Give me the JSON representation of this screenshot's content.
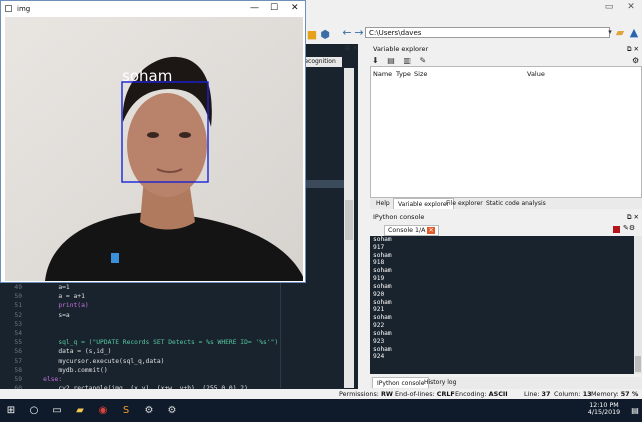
{
  "spyder": {
    "path_value": "C:\\Users\\daves",
    "editor_tab": "recognition",
    "variable_explorer": {
      "title": "Variable explorer",
      "columns": [
        "Name",
        "Type",
        "Size",
        "Value"
      ]
    },
    "bottom_tabs": [
      "Help",
      "Variable explorer",
      "File explorer",
      "Static code analysis"
    ],
    "ipython": {
      "title": "IPython console",
      "tab": "Console 1/A",
      "lines": [
        "soham",
        "917",
        "soham",
        "918",
        "soham",
        "919",
        "soham",
        "920",
        "soham",
        "921",
        "soham",
        "922",
        "soham",
        "923",
        "soham",
        "924"
      ]
    },
    "console_tabs": [
      "IPython console",
      "History log"
    ],
    "code": [
      {
        "n": "49",
        "text": "        a=1"
      },
      {
        "n": "50",
        "text": "        a = a+1"
      },
      {
        "n": "51",
        "text": "        print(a)"
      },
      {
        "n": "52",
        "text": "        s=a"
      },
      {
        "n": "53",
        "text": ""
      },
      {
        "n": "54",
        "text": ""
      },
      {
        "n": "55",
        "text": "        sql_q = (\"UPDATE Records SET Detects = %s WHERE ID= '%s'\")"
      },
      {
        "n": "56",
        "text": "        data = (s,id_)"
      },
      {
        "n": "57",
        "text": "        mycursor.execute(sql_q,data)"
      },
      {
        "n": "58",
        "text": "        mydb.commit()"
      },
      {
        "n": "59",
        "text": "    else:"
      },
      {
        "n": "60",
        "text": "        cv2.rectangle(img, (x,y) ,(x+w, y+h), (255,0,0),2)"
      }
    ],
    "status": {
      "permissions_label": "Permissions:",
      "permissions": "RW",
      "eol_label": "End-of-lines:",
      "eol": "CRLF",
      "encoding_label": "Encoding:",
      "encoding": "ASCII",
      "line_label": "Line:",
      "line": "37",
      "column_label": "Column:",
      "column": "13",
      "memory_label": "Memory:",
      "memory": "57 %"
    }
  },
  "img_window": {
    "title": "img",
    "face_label": "soham",
    "box_color": "#1a22d8",
    "label_color": "#ffffff"
  },
  "taskbar": {
    "time": "12:10 PM",
    "date": "4/15/2019",
    "icons": [
      "windows-icon",
      "search-icon",
      "task-view-icon",
      "chrome-icon",
      "file-explorer-icon",
      "sublime-icon",
      "settings-icon",
      "settings-icon"
    ]
  }
}
